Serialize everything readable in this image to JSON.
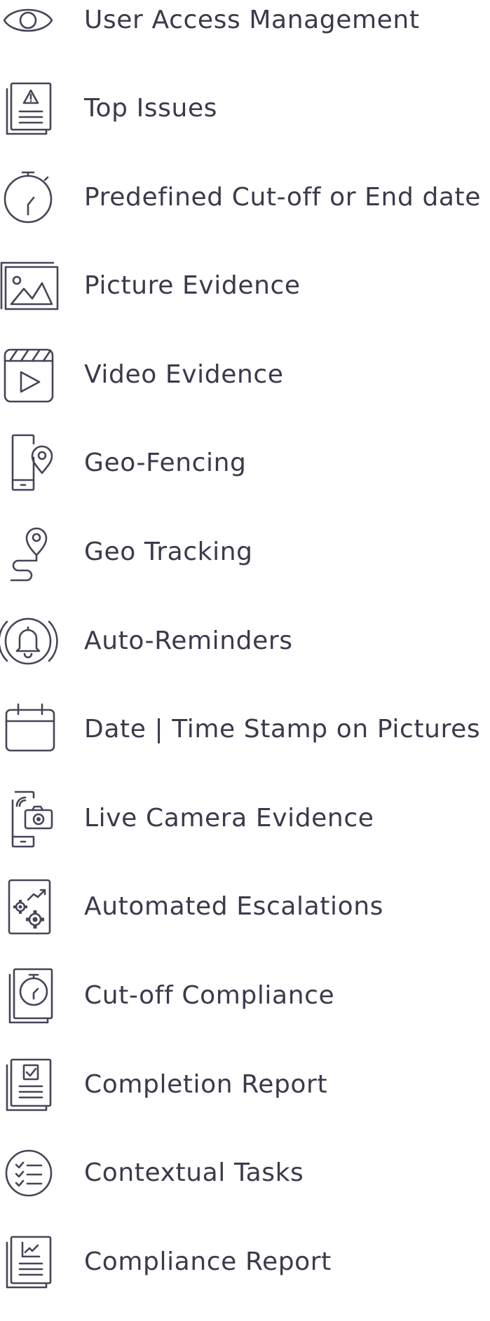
{
  "features": [
    {
      "label": "User Access Management",
      "icon": "eye-icon"
    },
    {
      "label": "Top Issues",
      "icon": "warning-document-icon"
    },
    {
      "label": "Predefined Cut-off or End date",
      "icon": "stopwatch-icon"
    },
    {
      "label": "Picture Evidence",
      "icon": "image-icon"
    },
    {
      "label": "Video Evidence",
      "icon": "video-clapper-icon"
    },
    {
      "label": "Geo-Fencing",
      "icon": "phone-location-pin-icon"
    },
    {
      "label": "Geo Tracking",
      "icon": "route-location-pin-icon"
    },
    {
      "label": "Auto-Reminders",
      "icon": "ringing-bell-icon"
    },
    {
      "label": "Date | Time Stamp on Pictures",
      "icon": "calendar-icon"
    },
    {
      "label": "Live Camera Evidence",
      "icon": "phone-camera-icon"
    },
    {
      "label": "Automated Escalations",
      "icon": "gears-trend-icon"
    },
    {
      "label": "Cut-off Compliance",
      "icon": "timer-document-icon"
    },
    {
      "label": "Completion Report",
      "icon": "checkbox-document-icon"
    },
    {
      "label": "Contextual Tasks",
      "icon": "checklist-icon"
    },
    {
      "label": "Compliance Report",
      "icon": "chart-document-icon"
    }
  ],
  "colors": {
    "text": "#3a3a4c",
    "icon_stroke": "#454558",
    "background": "#ffffff"
  }
}
